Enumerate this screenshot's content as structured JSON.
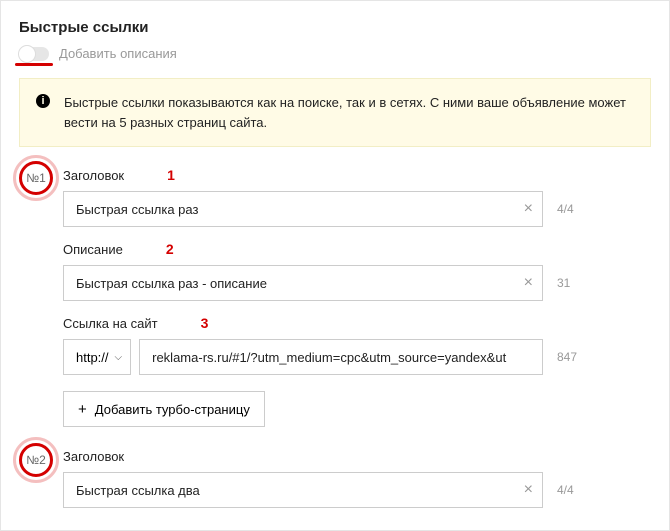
{
  "section_title": "Быстрые ссылки",
  "toggle_label": "Добавить описания",
  "info_text": "Быстрые ссылки показываются как на поиске, так и в сетях. С ними ваше объявление может вести на 5 разных страниц сайта.",
  "labels": {
    "title": "Заголовок",
    "description": "Описание",
    "site_link": "Ссылка на сайт"
  },
  "protocol": "http://",
  "add_turbo": "Добавить турбо-страницу",
  "annotations": {
    "a1": "1",
    "a2": "2",
    "a3": "3"
  },
  "links": [
    {
      "num": "№1",
      "title_value": "Быстрая ссылка раз",
      "title_counter": "4/4",
      "desc_value": "Быстрая ссылка раз - описание",
      "desc_counter": "31",
      "url_value": "reklama-rs.ru/#1/?utm_medium=cpc&utm_source=yandex&ut",
      "url_counter": "847"
    },
    {
      "num": "№2",
      "title_value": "Быстрая ссылка два",
      "title_counter": "4/4"
    }
  ]
}
